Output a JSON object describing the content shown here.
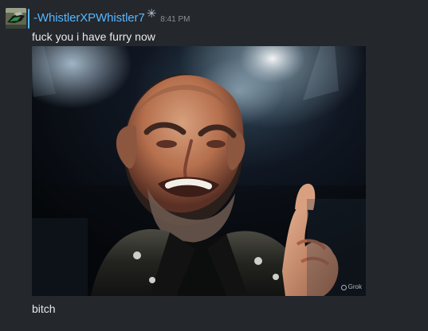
{
  "message": {
    "username": "-WhistlerXPWhistler7",
    "status_glyph": "✳",
    "timestamp": "8:41 PM",
    "lines": [
      "fuck you i have furry now",
      "bitch"
    ],
    "image": {
      "watermark_text": "Grok",
      "watermark_icon": "grok-logo-icon"
    }
  },
  "colors": {
    "background": "#24272c",
    "username": "#56b7ff",
    "text": "#e7e9ec",
    "timestamp": "#8a9099"
  },
  "icons": {
    "avatar": "avatar-icon",
    "status": "sparkle-icon"
  }
}
